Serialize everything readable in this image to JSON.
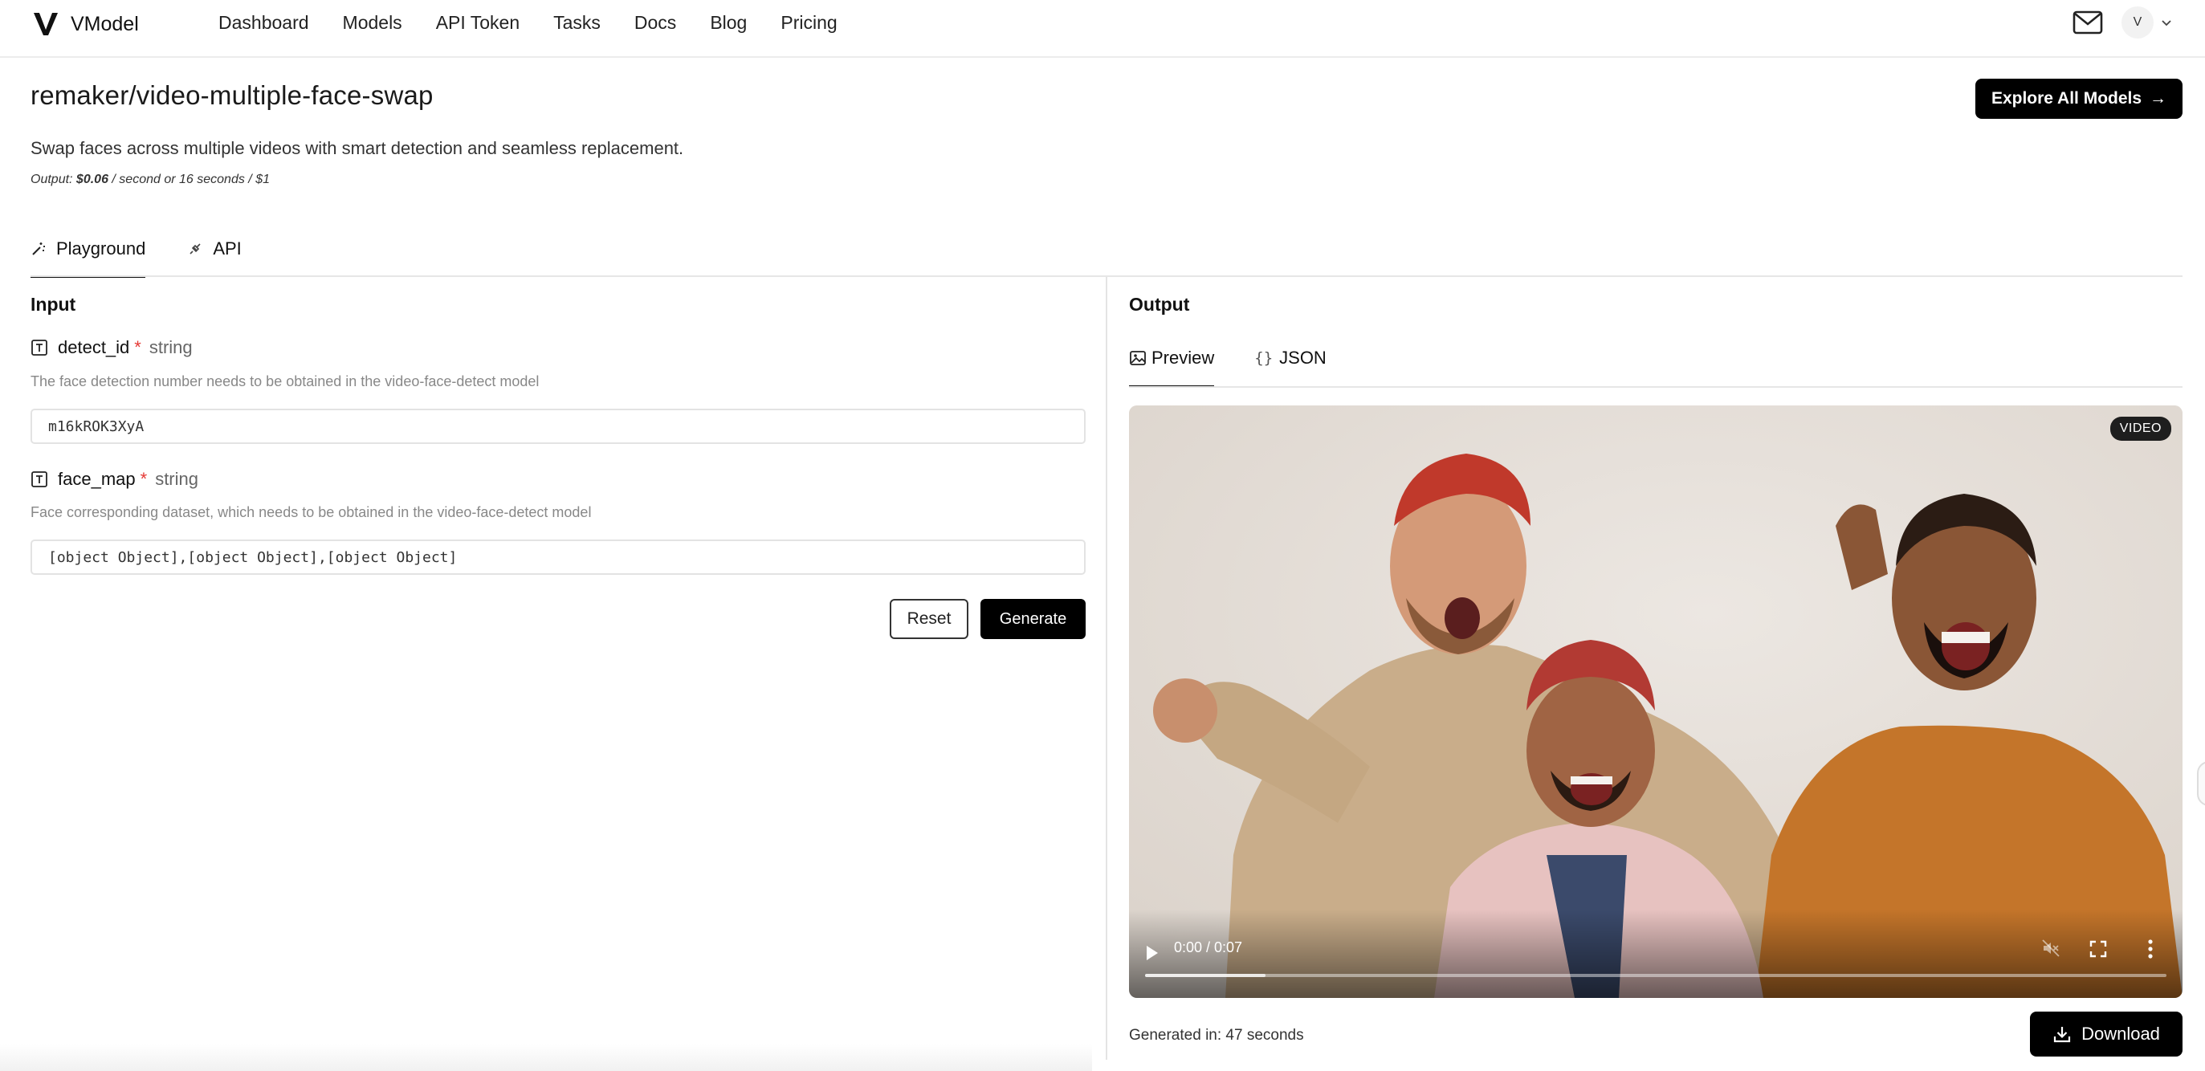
{
  "header": {
    "logo_text": "VModel",
    "nav": [
      "Dashboard",
      "Models",
      "API Token",
      "Tasks",
      "Docs",
      "Blog",
      "Pricing"
    ],
    "avatar_initial": "V",
    "icons": {
      "mail": "mail-icon",
      "chevron": "chevron-down-icon"
    }
  },
  "page": {
    "title": "remaker/video-multiple-face-swap",
    "explore_label": "Explore All Models",
    "explore_arrow": "→",
    "description": "Swap faces across multiple videos with smart detection and seamless replacement.",
    "price_prefix": "Output: ",
    "price_value": "$0.06",
    "price_suffix": " / second or 16 seconds / $1"
  },
  "tabs": {
    "playground": "Playground",
    "api": "API",
    "active": "Playground"
  },
  "input": {
    "heading": "Input",
    "fields": [
      {
        "name": "detect_id",
        "required": "*",
        "type": "string",
        "help": "The face detection number needs to be obtained in the video-face-detect model",
        "value": "m16kROK3XyA"
      },
      {
        "name": "face_map",
        "required": "*",
        "type": "string",
        "help": "Face corresponding dataset, which needs to be obtained in the video-face-detect model",
        "value": "[object Object],[object Object],[object Object]"
      }
    ],
    "reset_label": "Reset",
    "generate_label": "Generate"
  },
  "output": {
    "heading": "Output",
    "tabs": [
      "Preview",
      "JSON"
    ],
    "active_tab": "Preview",
    "json_braces": "{}",
    "video": {
      "badge": "VIDEO",
      "time": "0:00 / 0:07",
      "progress_buffered_fraction": 0.118,
      "muted": true
    },
    "generated_text": "Generated in: 47 seconds",
    "download_label": "Download"
  },
  "colors": {
    "primary": "#000000",
    "required": "#e53935",
    "border": "#e3e3e3",
    "muted_text": "#888888"
  }
}
